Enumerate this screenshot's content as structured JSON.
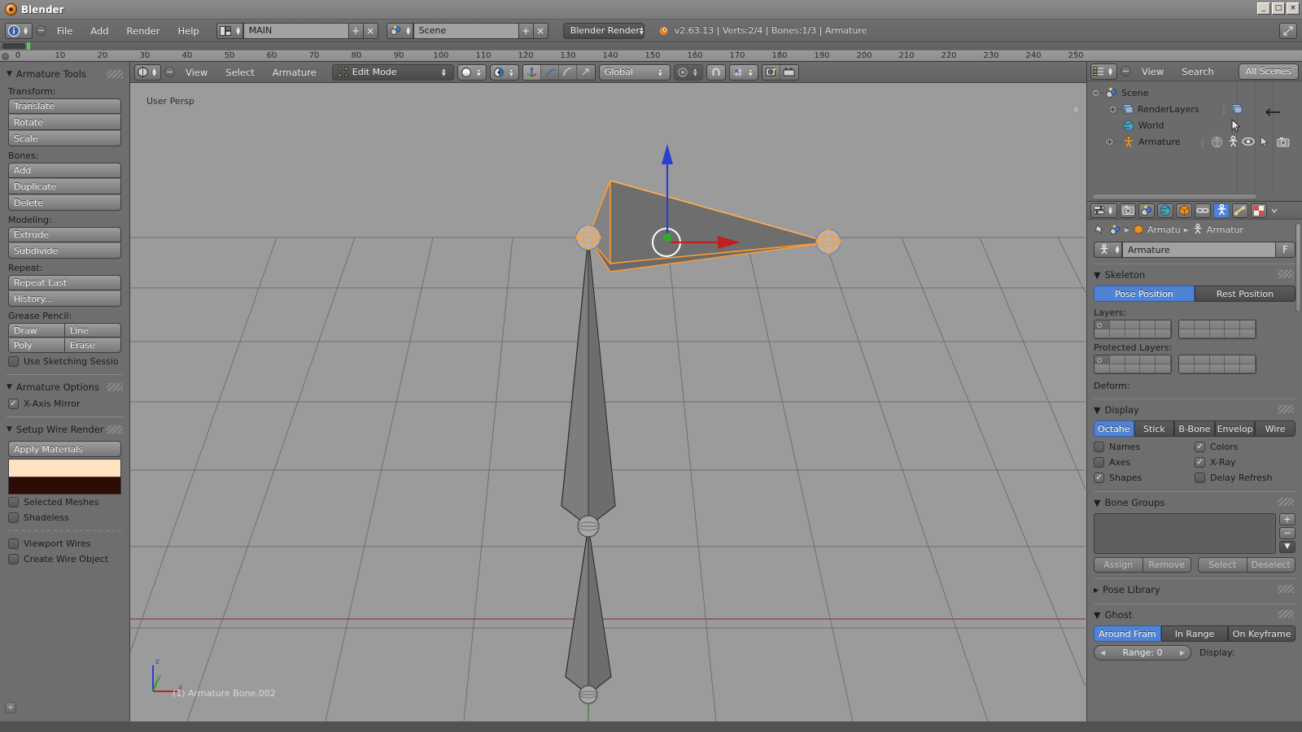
{
  "window": {
    "title": "Blender",
    "icon": "blender-logo-icon",
    "buttons": {
      "minimize": "_",
      "maximize": "□",
      "close": "×"
    }
  },
  "info_header": {
    "editor_icon": "info-editor-icon",
    "menus": [
      "File",
      "Add",
      "Render",
      "Help"
    ],
    "screen_datablock": {
      "icon": "screen-layout-icon",
      "value": "MAIN",
      "add": "+",
      "remove": "×"
    },
    "scene_datablock": {
      "icon": "scene-icon",
      "value": "Scene",
      "add": "+",
      "remove": "×"
    },
    "render_engine": "Blender Render",
    "version_info": "v2.63.13 | Verts:2/4 | Bones:1/3 | Armature",
    "maximize_icon": "maximize-area-icon"
  },
  "timeline": {
    "ticks": [
      0,
      10,
      20,
      30,
      40,
      50,
      60,
      70,
      80,
      90,
      100,
      110,
      120,
      130,
      140,
      150,
      160,
      170,
      180,
      190,
      200,
      210,
      220,
      230,
      240,
      250
    ],
    "current_frame": 1
  },
  "toolshelf": {
    "panel_title": "Armature Tools",
    "sections": [
      {
        "label": "Transform:",
        "buttons": [
          "Translate",
          "Rotate",
          "Scale"
        ]
      },
      {
        "label": "Bones:",
        "buttons": [
          "Add",
          "Duplicate",
          "Delete"
        ]
      },
      {
        "label": "Modeling:",
        "buttons": [
          "Extrude",
          "Subdivide"
        ]
      },
      {
        "label": "Repeat:",
        "buttons": [
          "Repeat Last",
          "History..."
        ]
      }
    ],
    "grease_pencil": {
      "label": "Grease Pencil:",
      "row1": [
        "Draw",
        "Line"
      ],
      "row2": [
        "Poly",
        "Erase"
      ],
      "checkbox": {
        "label": "Use Sketching Sessio",
        "checked": false
      }
    },
    "armature_options": {
      "title": "Armature Options",
      "checkbox": {
        "label": "X-Axis Mirror",
        "checked": true
      }
    },
    "setup_wire_render": {
      "title": "Setup Wire Render",
      "apply_button": "Apply Materials",
      "color_light": "#ffe2c1",
      "color_dark": "#2b0d06",
      "checkboxes": [
        {
          "label": "Selected Meshes",
          "checked": false
        },
        {
          "label": "Shadeless",
          "checked": false
        },
        {
          "label": "Viewport Wires",
          "checked": false
        },
        {
          "label": "Create Wire Object",
          "checked": false
        }
      ]
    }
  },
  "viewport_header": {
    "editor_icon": "3d-view-editor-icon",
    "menus": [
      "View",
      "Select",
      "Armature"
    ],
    "mode": {
      "icon": "edit-mode-icon",
      "value": "Edit Mode"
    },
    "shading": "solid-shading-icon",
    "pivot": "pivot-median-icon",
    "manipulators": [
      "translate-manipulator-icon",
      "rotate-manipulator-icon",
      "scale-manipulator-icon"
    ],
    "orientation": "Global",
    "proportional": "proportional-edit-icon",
    "snap": "magnet-icon",
    "snap_target": "snap-increment-icon",
    "render_icons": [
      "render-preview-icon",
      "render-animation-icon"
    ]
  },
  "viewport": {
    "view_label": "User Persp",
    "status_text": "(1) Armature Bone.002",
    "axis_gizmo": {
      "z": "z",
      "y": "y",
      "x": "x"
    },
    "colors": {
      "background": "#9b9b9b",
      "grid": "#6e6e6e",
      "bone_selected_outline": "#ff9c30",
      "bone_fill": "#777777",
      "axis_x": "#b52020",
      "axis_y": "#28a028",
      "axis_z": "#2030d0",
      "cursor_ring": "#ffffff"
    }
  },
  "outliner": {
    "editor_icon": "outliner-editor-icon",
    "menus": [
      "View",
      "Search"
    ],
    "display_mode": "All Scenes",
    "tree": [
      {
        "name": "Scene",
        "icon": "scene-icon",
        "indent": 0,
        "expander": "minus"
      },
      {
        "name": "RenderLayers",
        "icon": "renderlayers-icon",
        "indent": 1,
        "expander": "plus"
      },
      {
        "name": "World",
        "icon": "world-icon",
        "indent": 1,
        "expander": "none"
      },
      {
        "name": "Armature",
        "icon": "armature-object-icon",
        "indent": 1,
        "expander": "plus",
        "restrict_icons": [
          "restrict-render-icon",
          "armature-data-icon",
          "restrict-view-icon",
          "restrict-select-icon",
          "restrict-render-camera-icon"
        ]
      }
    ]
  },
  "properties": {
    "tabs": [
      {
        "name": "render-tab",
        "icon": "camera-icon",
        "active": false
      },
      {
        "name": "scene-tab",
        "icon": "scene-icon",
        "active": false
      },
      {
        "name": "world-tab",
        "icon": "world-icon",
        "active": false
      },
      {
        "name": "object-tab",
        "icon": "cube-icon",
        "active": false
      },
      {
        "name": "constraints-tab",
        "icon": "chain-icon",
        "active": false
      },
      {
        "name": "armature-data-tab",
        "icon": "armature-icon",
        "active": true
      },
      {
        "name": "bone-tab",
        "icon": "bone-icon",
        "active": false
      },
      {
        "name": "texture-tab",
        "icon": "checker-icon",
        "active": false
      }
    ],
    "breadcrumb": {
      "pin": "pin-icon",
      "scene": "scene-icon",
      "object": "Armatu",
      "data": "Armatur"
    },
    "id_block": {
      "icon": "armature-icon",
      "name": "Armature",
      "fake_user": "F"
    },
    "skeleton": {
      "title": "Skeleton",
      "pose_position": "Pose Position",
      "rest_position": "Rest Position",
      "active": "Pose Position",
      "layers_label": "Layers:",
      "protected_layers_label": "Protected Layers:",
      "deform_label": "Deform:"
    },
    "display": {
      "title": "Display",
      "modes": [
        "Octahe",
        "Stick",
        "B-Bone",
        "Envelop",
        "Wire"
      ],
      "active_mode": "Octahe",
      "checkboxes": [
        {
          "label": "Names",
          "checked": false
        },
        {
          "label": "Colors",
          "checked": true
        },
        {
          "label": "Axes",
          "checked": false
        },
        {
          "label": "X-Ray",
          "checked": true
        },
        {
          "label": "Shapes",
          "checked": true
        },
        {
          "label": "Delay Refresh",
          "checked": false
        }
      ]
    },
    "bone_groups": {
      "title": "Bone Groups",
      "buttons": [
        "Assign",
        "Remove",
        "Select",
        "Deselect"
      ],
      "add": "+",
      "remove": "−",
      "specials": "▼"
    },
    "pose_library": {
      "title": "Pose Library",
      "collapsed": true
    },
    "ghost": {
      "title": "Ghost",
      "modes": [
        "Around Fram",
        "In Range",
        "On Keyframe"
      ],
      "active_mode": "Around Fram",
      "range": "Range: 0",
      "display_label": "Display:"
    }
  }
}
